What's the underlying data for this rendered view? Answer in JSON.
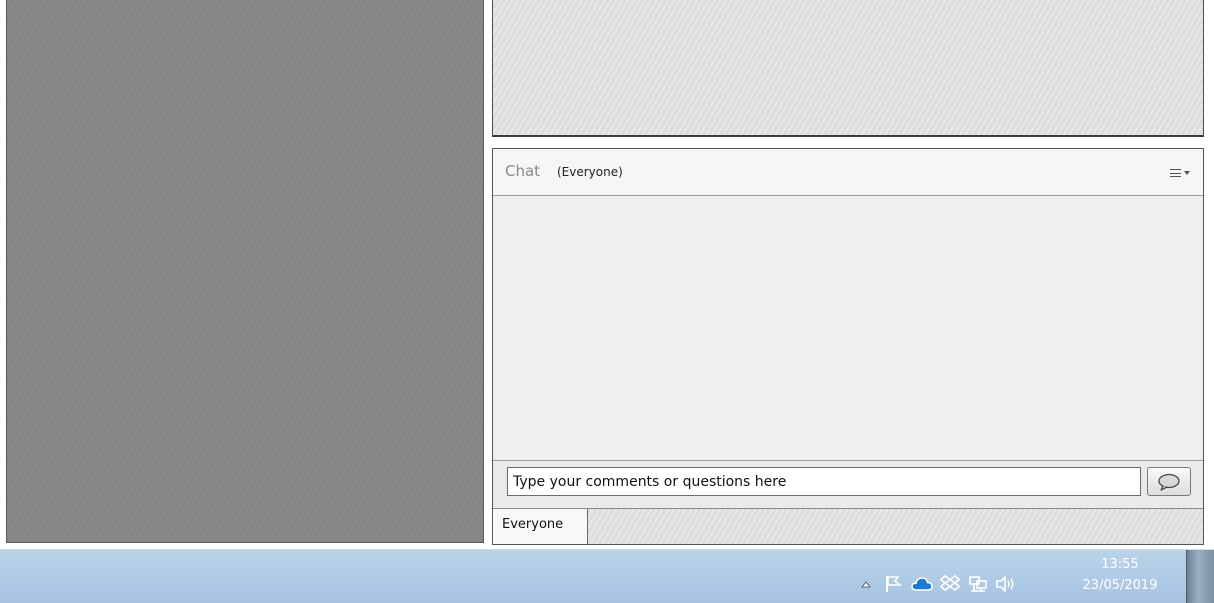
{
  "chat": {
    "title": "Chat",
    "subtitle": "(Everyone)",
    "input_value": "Type your comments or questions here",
    "recipient_tab": "Everyone"
  },
  "taskbar": {
    "time": "13:55",
    "date": "23/05/2019",
    "tray_icons": [
      "show-hidden-icons",
      "action-center-flag",
      "onedrive-cloud",
      "dropbox",
      "network",
      "volume"
    ]
  },
  "colors": {
    "taskbar": "#b4cfe8",
    "onedrive": "#1e7ad6",
    "panel": "#efefef"
  }
}
